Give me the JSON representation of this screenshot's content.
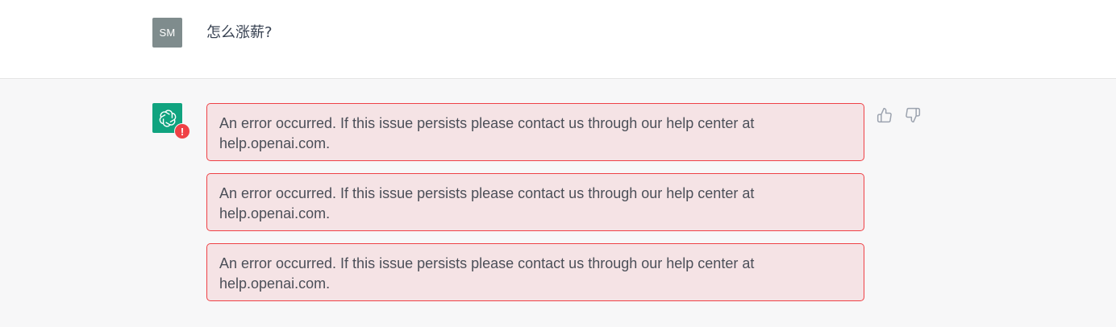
{
  "user_message": {
    "avatar_initials": "SM",
    "text": "怎么涨薪?"
  },
  "assistant_message": {
    "avatar_icon": "openai-logo-icon",
    "status_icon": "error-exclamation-icon",
    "status_glyph": "!",
    "errors": [
      {
        "text": "An error occurred. If this issue persists please contact us through our help center at help.openai.com."
      },
      {
        "text": "An error occurred. If this issue persists please contact us through our help center at help.openai.com."
      },
      {
        "text": "An error occurred. If this issue persists please contact us through our help center at help.openai.com."
      }
    ],
    "feedback": {
      "thumbs_up_icon": "thumbs-up-icon",
      "thumbs_down_icon": "thumbs-down-icon"
    }
  },
  "colors": {
    "brand_green": "#10a37f",
    "error_red": "#ef4146",
    "error_bg": "#f5e3e5",
    "user_avatar_bg": "#7f8c8d",
    "assistant_row_bg": "#f7f7f8"
  }
}
